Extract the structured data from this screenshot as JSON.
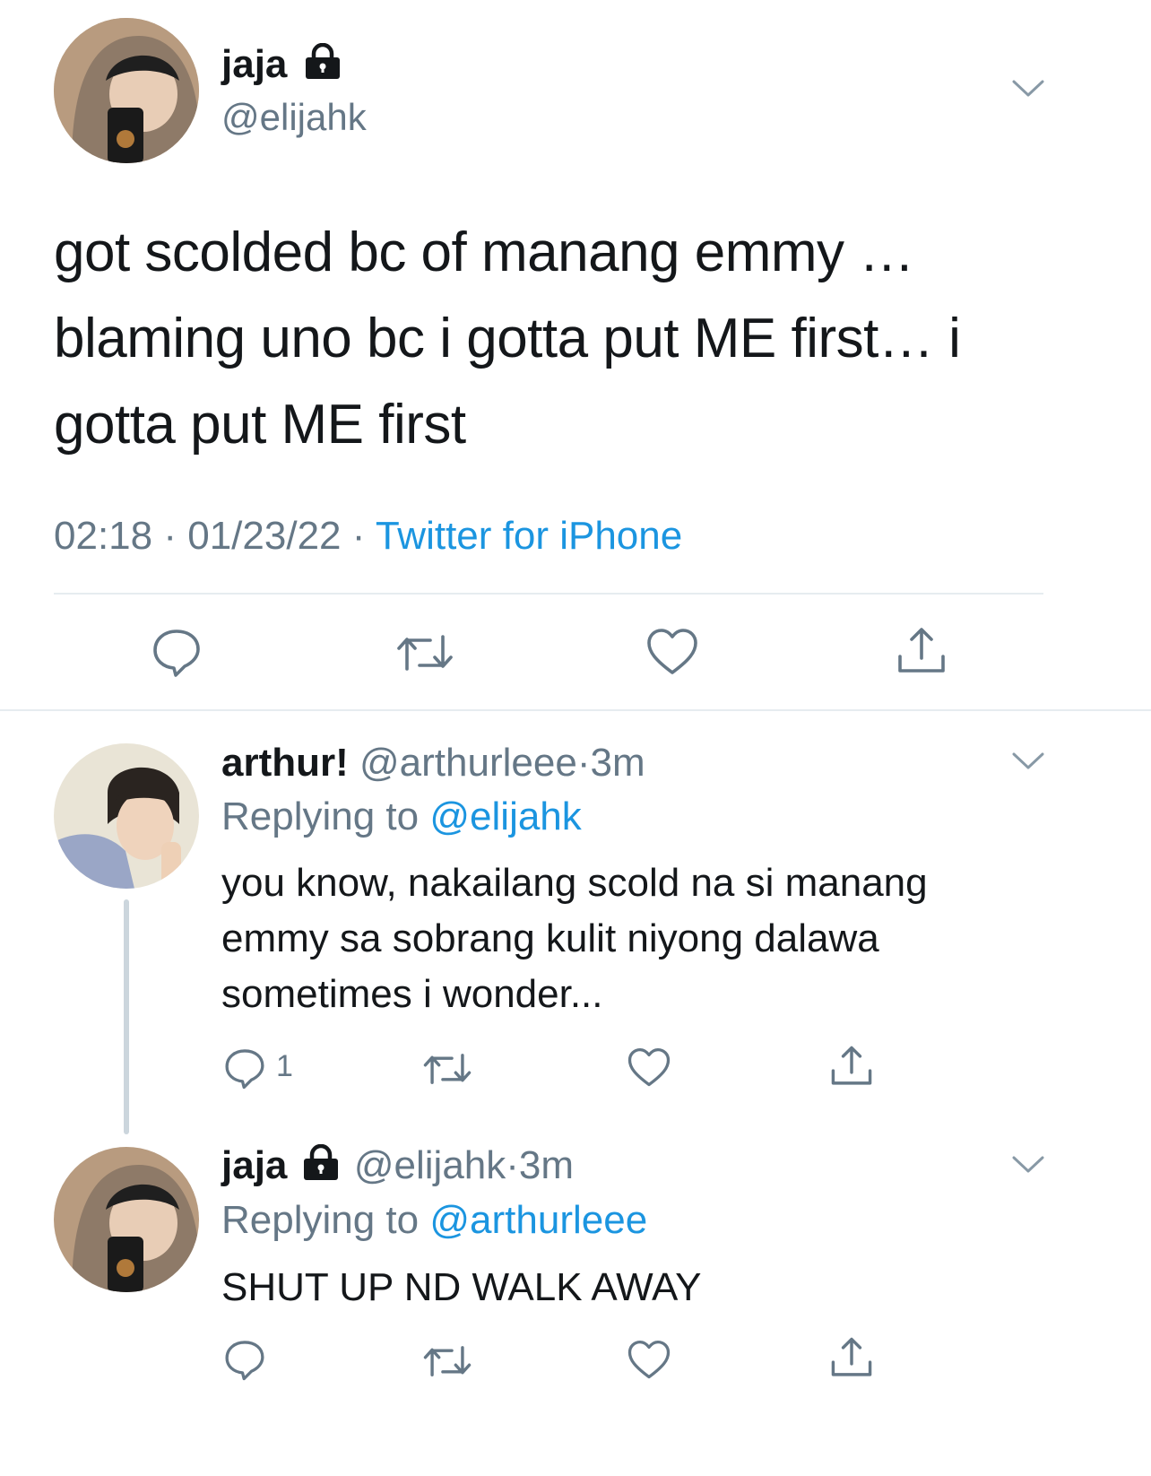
{
  "main_tweet": {
    "display_name": "jaja",
    "handle": "@elijahk",
    "text": "got scolded bc of manang emmy … blaming uno bc i gotta put ME first… i gotta put ME first",
    "time": "02:18",
    "separator": "·",
    "date": "01/23/22",
    "source": "Twitter for iPhone"
  },
  "replies": [
    {
      "display_name": "arthur!",
      "handle": "@arthurleee",
      "dot": "·",
      "age": "3m",
      "replying_label": "Replying to",
      "replying_to": "@elijahk",
      "text": "you know, nakailang scold na si manang emmy sa sobrang kulit niyong dalawa sometimes i wonder...",
      "reply_count": "1"
    },
    {
      "display_name": "jaja",
      "handle": "@elijahk",
      "dot": "·",
      "age": "3m",
      "replying_label": "Replying to",
      "replying_to": "@arthurleee",
      "text": "SHUT UP ND WALK AWAY"
    }
  ],
  "icons": {
    "reply": "reply-icon",
    "retweet": "retweet-icon",
    "like": "heart-icon",
    "share": "share-icon",
    "lock": "lock-icon",
    "more": "chevron-down-icon"
  },
  "colors": {
    "text": "#14171a",
    "secondary": "#657786",
    "link": "#1b95e0",
    "divider": "#e6ecf0"
  }
}
